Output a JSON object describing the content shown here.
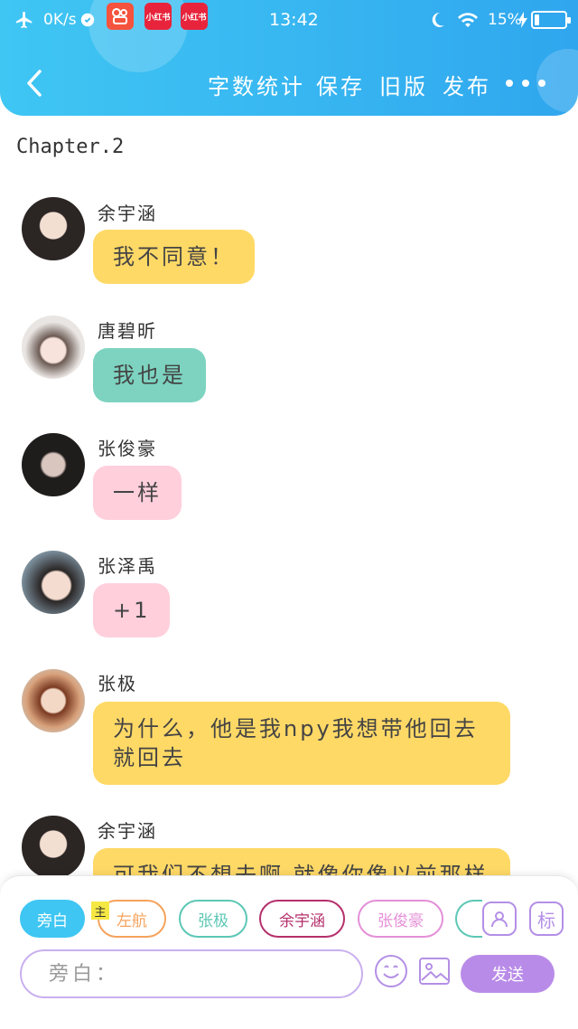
{
  "status_bar": {
    "net_speed": "0K/s",
    "app_badge_1": "小红书",
    "app_badge_2": "小红书",
    "time": "13:42",
    "battery": "15%",
    "battery_level": 0.15
  },
  "nav": {
    "word_count": "字数统计",
    "save": "保存",
    "old_version": "旧版",
    "publish": "发布"
  },
  "chapter_title": "Chapter.2",
  "messages": [
    {
      "sender": "余宇涵",
      "text": "我不同意！",
      "bubble_color": "#ffd966"
    },
    {
      "sender": "唐碧昕",
      "text": "我也是",
      "bubble_color": "#7dd3c0"
    },
    {
      "sender": "张俊豪",
      "text": "一样",
      "bubble_color": "#ffcfdc"
    },
    {
      "sender": "张泽禹",
      "text": "+1",
      "bubble_color": "#ffcfdc"
    },
    {
      "sender": "张极",
      "text": "为什么，他是我npy我想带他回去就回去",
      "bubble_color": "#ffd966"
    },
    {
      "sender": "余宇涵",
      "text": "可我们不想去啊 就像你像以前那样",
      "bubble_color": "#ffd966"
    }
  ],
  "roles": [
    {
      "label": "旁白",
      "color": "#3fc6f3",
      "active": true
    },
    {
      "label": "左航",
      "color": "#f5a35c"
    },
    {
      "label": "张极",
      "color": "#5cc7b5"
    },
    {
      "label": "余宇涵",
      "color": "#b5306b"
    },
    {
      "label": "张俊豪",
      "color": "#e58fd8"
    }
  ],
  "main_tag": "主",
  "tag_button": "标",
  "input": {
    "placeholder": "旁白："
  },
  "send_label": "发送"
}
